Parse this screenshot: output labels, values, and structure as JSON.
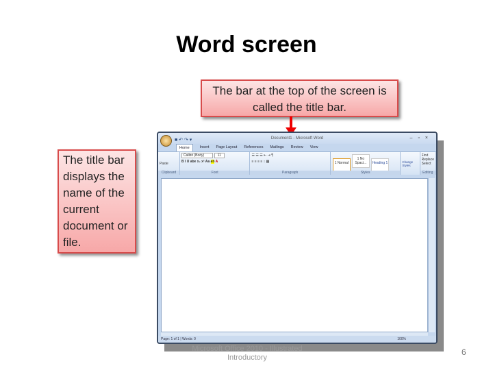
{
  "slide": {
    "title": "Word screen",
    "page_number": "6",
    "footer": "Microsoft Office 2010 - Illustrated Introductory"
  },
  "callouts": {
    "top": "The bar at the top of the screen is called the title bar.",
    "left": "The title bar displays the name of the current document or file."
  },
  "word": {
    "title_bar": "Document1 - Microsoft Word",
    "tabs": [
      "Home",
      "Insert",
      "Page Layout",
      "References",
      "Mailings",
      "Review",
      "View"
    ],
    "groups": [
      "Clipboard",
      "Font",
      "Paragraph",
      "Styles",
      "Editing"
    ],
    "font_name": "Calibri (Body)",
    "font_size": "11",
    "paste_label": "Paste",
    "styles": [
      "1 Normal",
      "1 No Spaci...",
      "Heading 1"
    ],
    "change_styles": "Change Styles",
    "editing": [
      "Find",
      "Replace",
      "Select"
    ],
    "status": {
      "page": "Page: 1 of 1",
      "words": "Words: 0",
      "zoom": "100%"
    }
  },
  "colors": {
    "callout_border": "#d84b4b",
    "arrow": "#e00000"
  }
}
